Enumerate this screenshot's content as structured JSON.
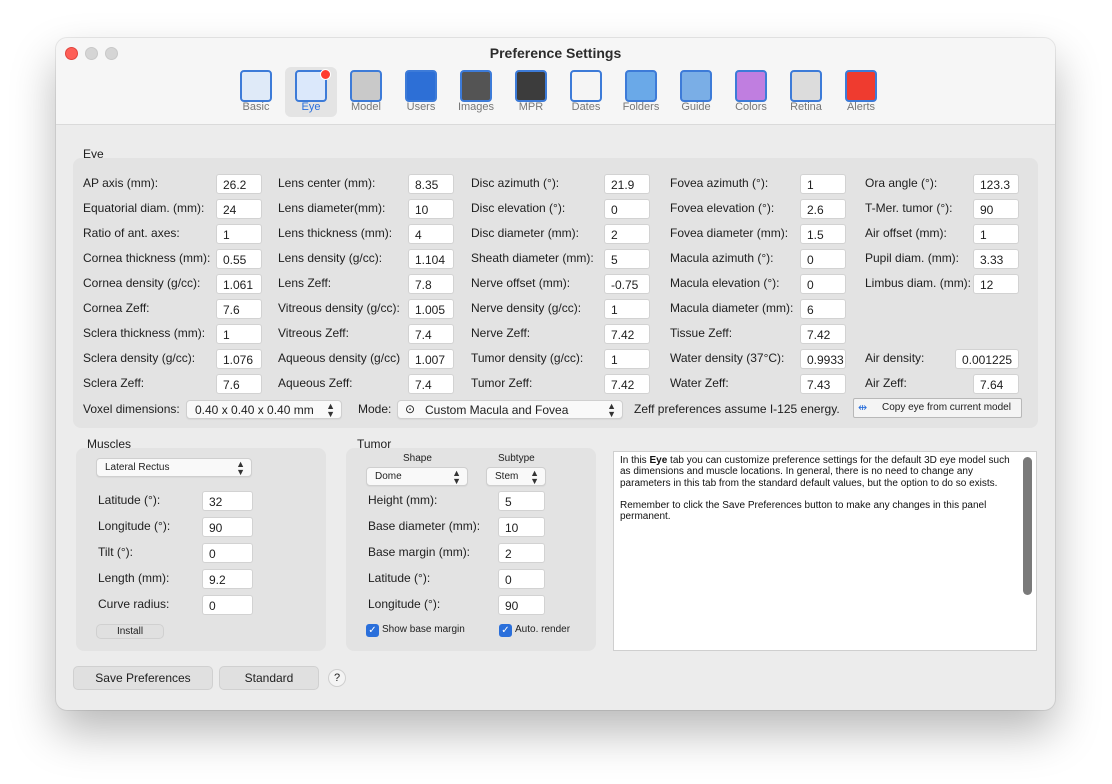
{
  "window": {
    "title": "Preference Settings"
  },
  "toolbar": [
    {
      "label": "Basic",
      "color": "#dfeaf8",
      "icon": "switch-icon"
    },
    {
      "label": "Eye",
      "color": "#dbe8fb",
      "icon": "eye-icon",
      "selected": true
    },
    {
      "label": "Model",
      "color": "#c9c9c9",
      "icon": "model-icon"
    },
    {
      "label": "Users",
      "color": "#2d6fd6",
      "icon": "user-icon"
    },
    {
      "label": "Images",
      "color": "#545454",
      "icon": "images-icon"
    },
    {
      "label": "MPR",
      "color": "#3c3c3c",
      "icon": "mpr-icon"
    },
    {
      "label": "Dates",
      "color": "#f5f5f5",
      "icon": "calendar-icon"
    },
    {
      "label": "Folders",
      "color": "#6aa9e8",
      "icon": "folder-icon"
    },
    {
      "label": "Guide",
      "color": "#7aaee6",
      "icon": "guide-icon"
    },
    {
      "label": "Colors",
      "color": "#c07ee0",
      "icon": "color-wheel-icon"
    },
    {
      "label": "Retina",
      "color": "#dcdcdc",
      "icon": "retina-icon"
    },
    {
      "label": "Alerts",
      "color": "#ef3b2f",
      "icon": "alert-icon"
    }
  ],
  "eye": {
    "section_label": "Eye",
    "col1": [
      {
        "label": "AP axis (mm):",
        "value": "26.2"
      },
      {
        "label": "Equatorial diam. (mm):",
        "value": "24"
      },
      {
        "label": "Ratio of ant. axes:",
        "value": "1"
      },
      {
        "label": "Cornea thickness (mm):",
        "value": "0.55"
      },
      {
        "label": "Cornea density (g/cc):",
        "value": "1.061"
      },
      {
        "label": "Cornea Zeff:",
        "value": "7.6"
      },
      {
        "label": "Sclera thickness (mm):",
        "value": "1"
      },
      {
        "label": "Sclera density (g/cc):",
        "value": "1.076"
      },
      {
        "label": "Sclera Zeff:",
        "value": "7.6"
      }
    ],
    "col2": [
      {
        "label": "Lens center (mm):",
        "value": "8.35"
      },
      {
        "label": "Lens diameter(mm):",
        "value": "10"
      },
      {
        "label": "Lens thickness (mm):",
        "value": "4"
      },
      {
        "label": "Lens density (g/cc):",
        "value": "1.104"
      },
      {
        "label": "Lens Zeff:",
        "value": "7.8"
      },
      {
        "label": "Vitreous density (g/cc):",
        "value": "1.005"
      },
      {
        "label": "Vitreous Zeff:",
        "value": "7.4"
      },
      {
        "label": "Aqueous density (g/cc)",
        "value": "1.007"
      },
      {
        "label": "Aqueous Zeff:",
        "value": "7.4"
      }
    ],
    "col3": [
      {
        "label": "Disc azimuth (°):",
        "value": "21.9"
      },
      {
        "label": "Disc elevation (°):",
        "value": "0"
      },
      {
        "label": "Disc diameter (mm):",
        "value": "2"
      },
      {
        "label": "Sheath diameter (mm):",
        "value": "5"
      },
      {
        "label": "Nerve offset (mm):",
        "value": "-0.75"
      },
      {
        "label": "Nerve density (g/cc):",
        "value": "1"
      },
      {
        "label": "Nerve Zeff:",
        "value": "7.42"
      },
      {
        "label": "Tumor density (g/cc):",
        "value": "1"
      },
      {
        "label": "Tumor Zeff:",
        "value": "7.42"
      }
    ],
    "col4": [
      {
        "label": "Fovea azimuth (°):",
        "value": "1"
      },
      {
        "label": "Fovea elevation (°):",
        "value": "2.6"
      },
      {
        "label": "Fovea diameter (mm):",
        "value": "1.5"
      },
      {
        "label": "Macula azimuth (°):",
        "value": "0"
      },
      {
        "label": "Macula elevation (°):",
        "value": "0"
      },
      {
        "label": "Macula diameter (mm):",
        "value": "6"
      },
      {
        "label": "Tissue Zeff:",
        "value": "7.42"
      },
      {
        "label": "Water density (37°C):",
        "value": "0.9933"
      },
      {
        "label": "Water Zeff:",
        "value": "7.43"
      }
    ],
    "col5": [
      {
        "label": "Ora angle (°):",
        "value": "123.3"
      },
      {
        "label": "T-Mer. tumor (°):",
        "value": "90"
      },
      {
        "label": "Air offset (mm):",
        "value": "1"
      },
      {
        "label": "Pupil diam. (mm):",
        "value": "3.33"
      },
      {
        "label": "Limbus diam. (mm):",
        "value": "12"
      },
      {
        "label": "Air density:",
        "value": "0.001225"
      },
      {
        "label": "Air Zeff:",
        "value": "7.64"
      }
    ],
    "voxel_label": "Voxel dimensions:",
    "voxel_value": "0.40 x 0.40 x 0.40 mm",
    "mode_label": "Mode:",
    "mode_value": "Custom Macula and Fovea",
    "zeff_note": "Zeff preferences assume I-125 energy.",
    "copy_button": "Copy eye from current model"
  },
  "muscles": {
    "section_label": "Muscles",
    "selected": "Lateral Rectus",
    "rows": [
      {
        "label": "Latitude (°):",
        "value": "32"
      },
      {
        "label": "Longitude (°):",
        "value": "90"
      },
      {
        "label": "Tilt (°):",
        "value": "0"
      },
      {
        "label": "Length (mm):",
        "value": "9.2"
      },
      {
        "label": "Curve radius:",
        "value": "0"
      }
    ],
    "install_button": "Install"
  },
  "tumor": {
    "section_label": "Tumor",
    "shape_label": "Shape",
    "shape_value": "Dome",
    "subtype_label": "Subtype",
    "subtype_value": "Stem",
    "rows": [
      {
        "label": "Height (mm):",
        "value": "5"
      },
      {
        "label": "Base diameter (mm):",
        "value": "10"
      },
      {
        "label": "Base margin (mm):",
        "value": "2"
      },
      {
        "label": "Latitude (°):",
        "value": "0"
      },
      {
        "label": "Longitude (°):",
        "value": "90"
      }
    ],
    "show_base_margin": "Show base margin",
    "auto_render": "Auto. render"
  },
  "info": {
    "p1_pre": "In this ",
    "p1_bold": "Eye",
    "p1_post": " tab you can customize preference settings for the default 3D eye model such as dimensions and muscle locations. In general, there is no need to change any parameters in this tab from the standard default values, but the option to do so exists.",
    "p2": "Remember to click the Save Preferences button to make any changes in this panel permanent."
  },
  "footer": {
    "save": "Save Preferences",
    "standard": "Standard",
    "help": "?"
  }
}
